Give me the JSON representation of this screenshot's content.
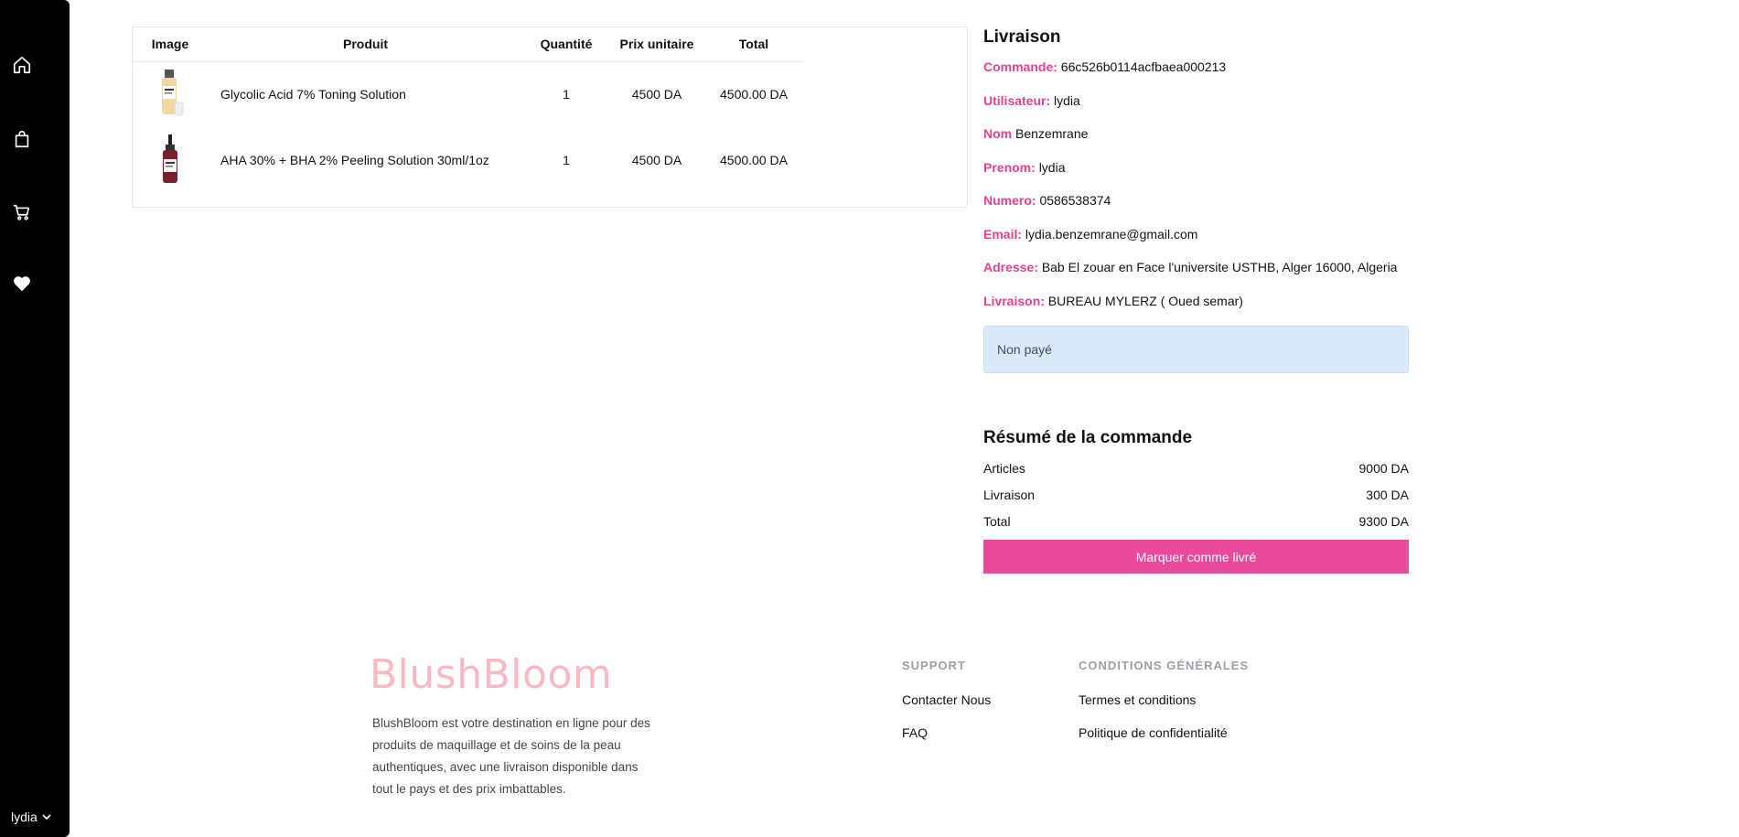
{
  "sidebar": {
    "icons": [
      "home-icon",
      "bag-icon",
      "cart-icon",
      "heart-icon"
    ],
    "user_label": "lydia"
  },
  "order_table": {
    "headers": [
      "Image",
      "Produit",
      "Quantité",
      "Prix unitaire",
      "Total"
    ],
    "rows": [
      {
        "name": "Glycolic Acid 7% Toning Solution",
        "qty": "1",
        "unit_price": "4500 DA",
        "total": "4500.00 DA"
      },
      {
        "name": "AHA 30% + BHA 2% Peeling Solution 30ml/1oz",
        "qty": "1",
        "unit_price": "4500 DA",
        "total": "4500.00 DA"
      }
    ]
  },
  "delivery": {
    "title": "Livraison",
    "fields": [
      {
        "key": "Commande:",
        "value": "66c526b0114acfbaea000213"
      },
      {
        "key": "Utilisateur:",
        "value": "lydia"
      },
      {
        "key": "Nom",
        "value": "Benzemrane"
      },
      {
        "key": "Prenom:",
        "value": "lydia"
      },
      {
        "key": "Numero:",
        "value": "0586538374"
      },
      {
        "key": "Email:",
        "value": "lydia.benzemrane@gmail.com"
      },
      {
        "key": "Adresse:",
        "value": "Bab El zouar en Face l'universite USTHB, Alger 16000, Algeria"
      },
      {
        "key": "Livraison:",
        "value": "BUREAU MYLERZ ( Oued semar)"
      }
    ],
    "status": "Non payé"
  },
  "summary": {
    "title": "Résumé de la commande",
    "rows": [
      {
        "label": "Articles",
        "value": "9000 DA"
      },
      {
        "label": "Livraison",
        "value": "300 DA"
      },
      {
        "label": "Total",
        "value": "9300 DA"
      }
    ],
    "button_label": "Marquer comme livré"
  },
  "footer": {
    "brand": "BlushBloom",
    "description": "BlushBloom est votre destination en ligne pour des produits de maquillage et de soins de la peau authentiques, avec une livraison disponible dans tout le pays et des prix imbattables.",
    "support": {
      "title": "SUPPORT",
      "links": [
        "Contacter Nous",
        "FAQ"
      ]
    },
    "conditions": {
      "title": "CONDITIONS GÉNÉRALES",
      "links": [
        "Termes et conditions",
        "Politique de confidentialité"
      ]
    }
  },
  "colors": {
    "accent": "#ea4a9b",
    "label_pink": "#e8418c",
    "status_bg": "#dbe9fd",
    "brand": "#f8b9c3"
  }
}
